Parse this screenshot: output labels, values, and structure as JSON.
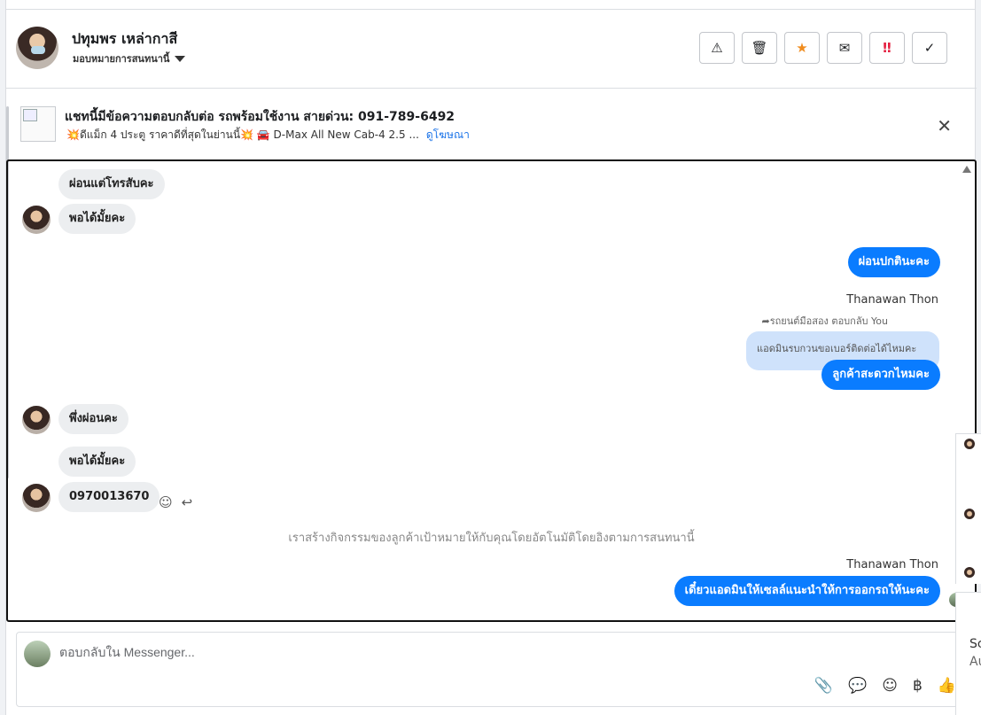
{
  "header": {
    "contact_name": "ปทุมพร เหล่ากาสี",
    "assign_label": "มอบหมายการสนทนานี้",
    "actions": [
      {
        "name": "warning-icon",
        "glyph": "⚠"
      },
      {
        "name": "trash-icon",
        "glyph": "🗑"
      },
      {
        "name": "star-icon",
        "glyph": "★"
      },
      {
        "name": "envelope-open-icon",
        "glyph": "✉"
      },
      {
        "name": "important-icon",
        "glyph": "‼"
      },
      {
        "name": "check-icon",
        "glyph": "✓"
      }
    ],
    "star_color": "#f08c1e",
    "important_color": "#e41e3f"
  },
  "ad": {
    "title": "แชทนี้มีข้อความตอบกลับต่อ รถพร้อมใช้งาน สายด่วน: 091-789-6492",
    "subtitle": "💥ดีแม็ก 4 ประตู ราคาดีที่สุดในย่านนี้💥 🚘 D-Max All New Cab-4 2.5 ...",
    "link": "ดูโฆษณา"
  },
  "messages": {
    "m1": "ผ่อนแต่โทรสับคะ",
    "m2": "พอได้มั้ยคะ",
    "m3": "ผ่อนปกตินะคะ",
    "sender1": "Thanawan Thon",
    "reply_meta": "รถยนต์มือสอง ตอบกลับ You",
    "quote": "แอดมินรบกวนขอเบอร์ติดต่อได้ไหมคะ",
    "m4": "ลูกค้าสะดวกไหมคะ",
    "m5": "พึ่งผ่อนคะ",
    "m6": "พอได้มั้ยคะ",
    "m7": "0970013670",
    "system": "เราสร้างกิจกรรมของลูกค้าเป้าหมายให้กับคุณโดยอัตโนมัติโดยอิงตามการสนทนานี้",
    "sender2": "Thanawan Thon",
    "m8": "เดี๋ยวแอดมินให้เซลล์แนะนำให้การออกรถให้นะคะ"
  },
  "composer": {
    "placeholder": "ตอบกลับใน Messenger..."
  },
  "side": {
    "s1": "Sc",
    "s2": "Au"
  },
  "accent_color": "#0a7cff"
}
